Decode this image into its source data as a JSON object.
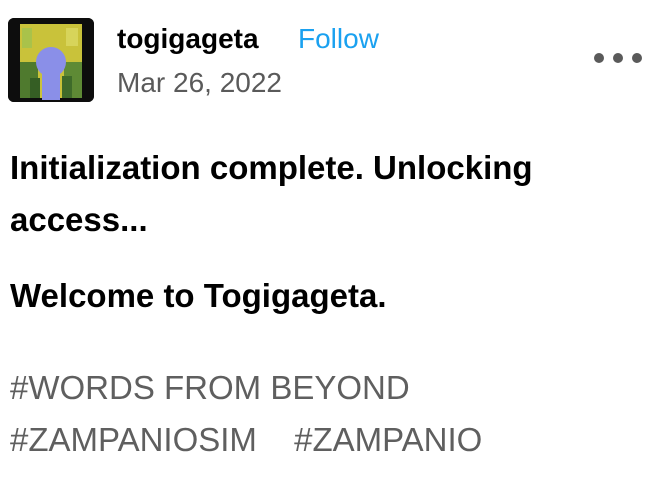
{
  "post": {
    "author": {
      "name": "togigageta",
      "follow_label": "Follow",
      "avatar_icon": "keyhole-avatar"
    },
    "date": "Mar 26, 2022",
    "more_icon": "ellipsis-icon",
    "body": {
      "paragraphs": [
        "Initialization complete. Unlocking access...",
        "Welcome to Togigageta."
      ]
    },
    "tags": [
      "#WORDS FROM BEYOND",
      "#ZAMPANIOSIM",
      "#ZAMPANIO"
    ]
  },
  "colors": {
    "follow": "#1aa1f0",
    "secondary_text": "#5a5a5a",
    "tag_text": "#5f5f5f",
    "avatar_keyhole": "#8a8fe8"
  }
}
